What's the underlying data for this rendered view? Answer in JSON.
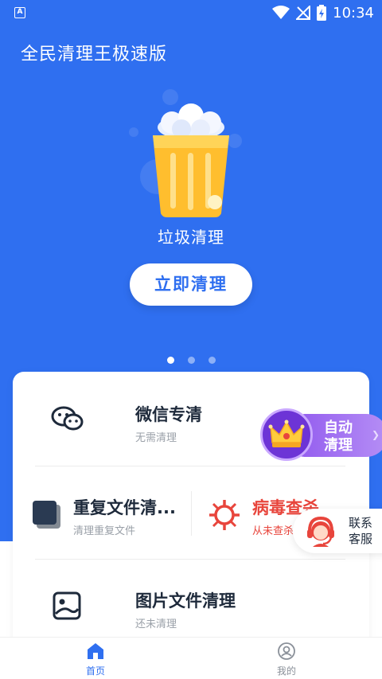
{
  "status_bar": {
    "time": "10:34"
  },
  "app": {
    "title": "全民清理王极速版"
  },
  "hero": {
    "feature_title": "垃圾清理",
    "button_label": "立即清理"
  },
  "features": [
    {
      "title": "微信专清",
      "subtitle": "无需清理",
      "icon": "wechat-icon"
    },
    {
      "title": "重复文件清...",
      "subtitle": "清理重复文件",
      "icon": "duplicate-files-icon"
    },
    {
      "title": "病毒查杀",
      "subtitle": "从未查杀",
      "icon": "virus-icon",
      "accent": "#e8453c"
    },
    {
      "title": "图片文件清理",
      "subtitle": "还未清理",
      "icon": "image-icon"
    }
  ],
  "auto_clean": {
    "line1": "自动",
    "line2": "清理"
  },
  "customer_service": {
    "line1": "联系",
    "line2": "客服"
  },
  "bottom_nav": [
    {
      "label": "首页",
      "icon": "home-icon",
      "active": true
    },
    {
      "label": "我的",
      "icon": "profile-icon",
      "active": false
    }
  ],
  "colors": {
    "primary": "#2f6ff0",
    "danger": "#e8453c",
    "text_dark": "#1e2a3b"
  }
}
